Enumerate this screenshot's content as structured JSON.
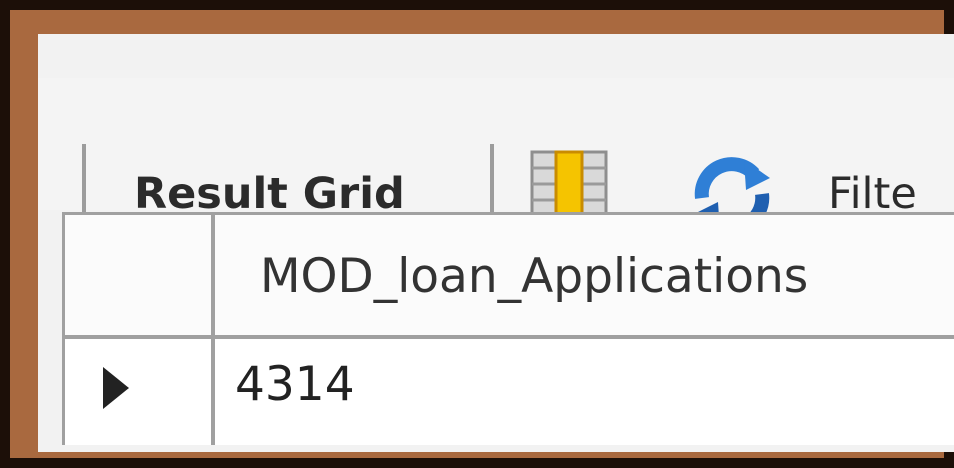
{
  "toolbar": {
    "result_grid_label": "Result Grid",
    "grid_toggle_icon": "grid-columns-icon",
    "refresh_icon": "refresh-icon",
    "filter_label": "Filte"
  },
  "result_grid": {
    "columns": [
      "MOD_loan_Applications"
    ],
    "rows": [
      [
        "4314"
      ]
    ],
    "row_indicator_icon": "current-row-arrow-icon"
  },
  "colors": {
    "frame": "#a9693f",
    "background": "#1c0f08",
    "panel": "#f2f2f2",
    "grid_icon_highlight": "#f5c400",
    "refresh_icon": "#2f7fd6"
  }
}
